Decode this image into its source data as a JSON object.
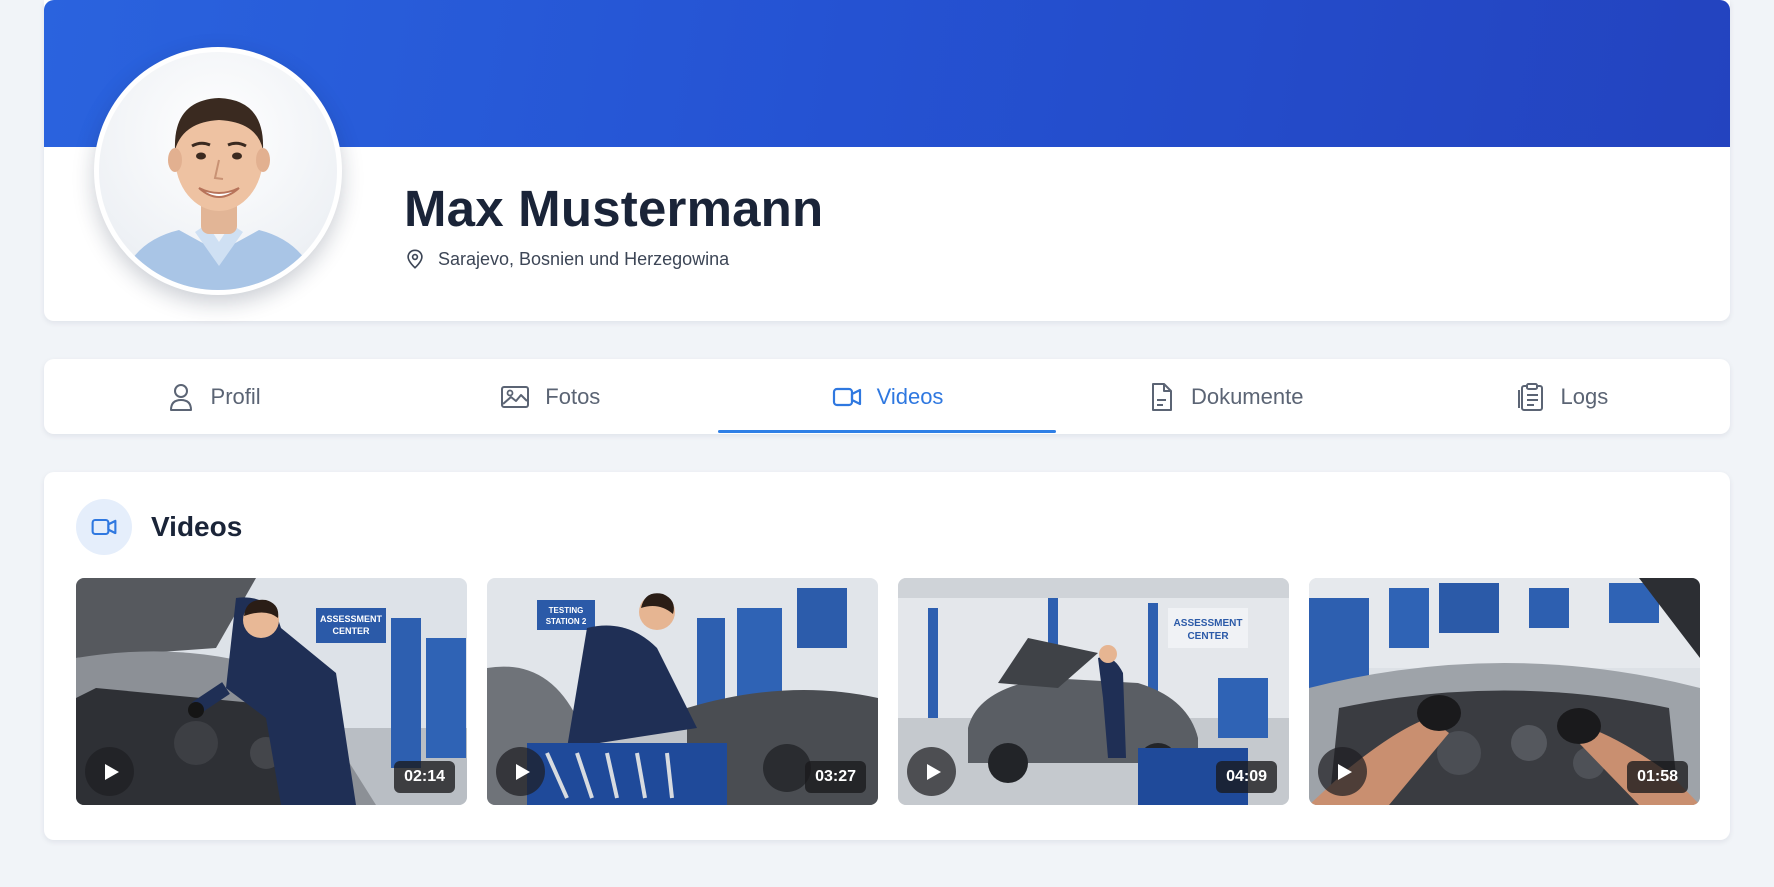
{
  "profile": {
    "name": "Max Mustermann",
    "location": "Sarajevo, Bosnien und Herzegowina"
  },
  "tabs": [
    {
      "label": "Profil",
      "icon": "user-icon",
      "active": false
    },
    {
      "label": "Fotos",
      "icon": "image-icon",
      "active": false
    },
    {
      "label": "Videos",
      "icon": "video-icon",
      "active": true
    },
    {
      "label": "Dokumente",
      "icon": "document-icon",
      "active": false
    },
    {
      "label": "Logs",
      "icon": "clipboard-icon",
      "active": false
    }
  ],
  "videos_section": {
    "title": "Videos",
    "icon": "video-icon",
    "items": [
      {
        "duration": "02:14",
        "sign": "ASSESSMENT CENTER"
      },
      {
        "duration": "03:27",
        "sign": "TESTING STATION 2"
      },
      {
        "duration": "04:09",
        "sign": "ASSESSMENT CENTER"
      },
      {
        "duration": "01:58",
        "sign": ""
      }
    ]
  },
  "colors": {
    "cover_start": "#2a63de",
    "cover_end": "#2343bf",
    "accent": "#2f78e0",
    "background": "#f1f4f8",
    "mechanic_uniform": "#1f2f55"
  }
}
